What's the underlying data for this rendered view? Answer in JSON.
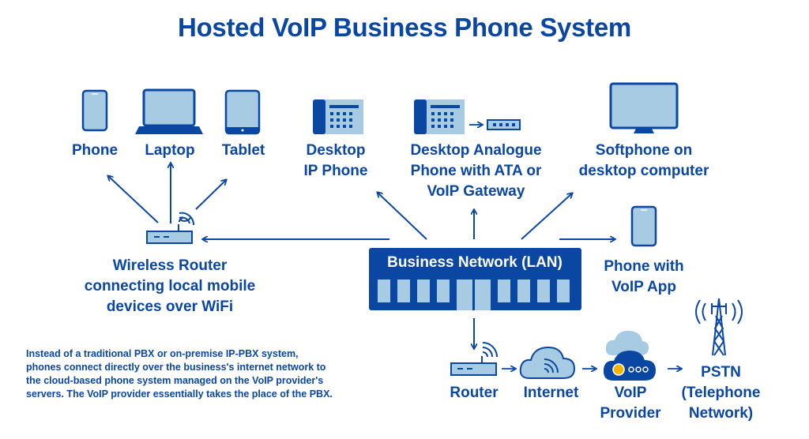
{
  "title": "Hosted VoIP Business Phone System",
  "colors": {
    "primary": "#0a47a3",
    "light": "#a6cbe3",
    "accent": "#f5b400",
    "background": "#ffffff"
  },
  "devices": {
    "phone": {
      "label": "Phone",
      "icon": "smartphone-icon"
    },
    "laptop": {
      "label": "Laptop",
      "icon": "laptop-icon"
    },
    "tablet": {
      "label": "Tablet",
      "icon": "tablet-icon"
    },
    "desktop_ip_phone": {
      "line1": "Desktop",
      "line2": "IP Phone",
      "icon": "desk-phone-icon"
    },
    "analogue_phone": {
      "line1": "Desktop Analogue",
      "line2": "Phone with ATA or",
      "line3": "VoIP Gateway",
      "icon": "desk-phone-ata-icon"
    },
    "softphone": {
      "line1": "Softphone on",
      "line2": "desktop computer",
      "icon": "monitor-icon"
    },
    "voip_app_phone": {
      "line1": "Phone with",
      "line2": "VoIP App",
      "icon": "smartphone-icon"
    },
    "wireless_router": {
      "line1": "Wireless Router",
      "line2": "connecting local mobile",
      "line3": "devices over WiFi",
      "icon": "wifi-router-icon"
    }
  },
  "lan": {
    "label": "Business Network (LAN)",
    "icon": "office-building-icon"
  },
  "chain": [
    {
      "label": "Router",
      "icon": "router-icon"
    },
    {
      "label": "Internet",
      "icon": "cloud-wifi-icon"
    },
    {
      "line1": "VoIP",
      "line2": "Provider",
      "icon": "cloud-server-icon"
    },
    {
      "line1": "PSTN",
      "line2": "(Telephone",
      "line3": "Network)",
      "icon": "cell-tower-icon"
    }
  ],
  "note": {
    "line1": "Instead of a traditional PBX or on-premise IP-PBX system,",
    "line2": "phones connect directly over the business's internet network to",
    "line3": "the cloud-based phone system managed on the VoIP provider's",
    "line4": "servers. The VoIP provider essentially takes the place of the PBX."
  }
}
